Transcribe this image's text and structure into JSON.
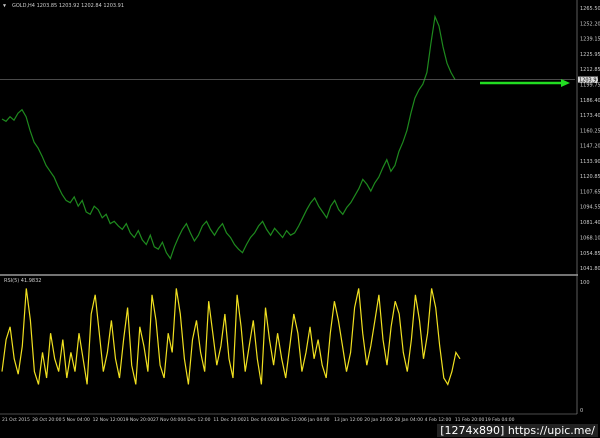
{
  "header": {
    "symbol_ohlc": "GOLD,H4 1203.85 1203.92 1202.84 1203.91",
    "menu_icon": "triangle-down-icon"
  },
  "indicator": {
    "label": "RSI(5) 41.9832"
  },
  "price_axis_labels": [
    "1265.50",
    "1252.20",
    "1239.15",
    "1225.95",
    "1212.85",
    "1199.75",
    "1186.40",
    "1173.40",
    "1160.25",
    "1147.20",
    "1133.90",
    "1120.85",
    "1107.65",
    "1094.55",
    "1081.40",
    "1068.10",
    "1054.85",
    "1041.80"
  ],
  "current_price": "1203.91",
  "rsi_axis_labels": [
    "100",
    "0"
  ],
  "time_axis_labels": [
    "21 Oct 2015",
    "28 Oct 20:00",
    "5 Nov 04:00",
    "12 Nov 12:00",
    "19 Nov 20:00",
    "27 Nov 04:00",
    "4 Dec 12:00",
    "11 Dec 20:00",
    "21 Dec 04:00",
    "28 Dec 12:00",
    "6 Jan 04:00",
    "13 Jan 12:00",
    "20 Jan 20:00",
    "28 Jan 04:00",
    "4 Feb 12:00",
    "11 Feb 20:00",
    "19 Feb 04:00"
  ],
  "watermark": "[1274x890] https://upic.me/",
  "colors": {
    "background": "#000000",
    "price_line": "#1e8a1e",
    "rsi_line": "#f0e020",
    "arrow": "#22dd22",
    "separator": "#9a9a9a",
    "axis_text": "#cccccc"
  },
  "chart_data": [
    {
      "type": "line",
      "series": [
        {
          "values": [
            1170,
            1168,
            1172,
            1169,
            1175,
            1178,
            1172,
            1160,
            1150,
            1145,
            1138,
            1130,
            1125,
            1120,
            1112,
            1105,
            1100,
            1098,
            1103,
            1095,
            1100,
            1090,
            1088,
            1095,
            1092,
            1085,
            1088,
            1080,
            1082,
            1078,
            1075,
            1080,
            1072,
            1068,
            1074,
            1066,
            1062,
            1070,
            1060,
            1058,
            1064,
            1055,
            1050,
            1060,
            1068,
            1075,
            1080,
            1072,
            1065,
            1070,
            1078,
            1082,
            1075,
            1070,
            1076,
            1080,
            1072,
            1068,
            1062,
            1058,
            1055,
            1062,
            1068,
            1072,
            1078,
            1082,
            1075,
            1070,
            1076,
            1072,
            1068,
            1074,
            1070,
            1072,
            1078,
            1085,
            1092,
            1098,
            1102,
            1095,
            1090,
            1085,
            1095,
            1100,
            1092,
            1088,
            1094,
            1098,
            1104,
            1110,
            1118,
            1114,
            1108,
            1115,
            1120,
            1128,
            1135,
            1125,
            1130,
            1142,
            1150,
            1160,
            1175,
            1188,
            1195,
            1200,
            1210,
            1235,
            1258,
            1250,
            1232,
            1218,
            1210,
            1204
          ]
        }
      ],
      "ylim": [
        1041.8,
        1265.5
      ],
      "ytick_labels": [
        "1265.50",
        "1252.20",
        "1239.15",
        "1225.95",
        "1212.85",
        "1199.75",
        "1186.40",
        "1173.40",
        "1160.25",
        "1147.20",
        "1133.90",
        "1120.85",
        "1107.65",
        "1094.55",
        "1081.40",
        "1068.10",
        "1054.85",
        "1041.80"
      ],
      "current_price": 1203.91
    },
    {
      "type": "line",
      "series": [
        {
          "values": [
            30,
            55,
            65,
            40,
            28,
            50,
            95,
            70,
            30,
            20,
            45,
            25,
            60,
            40,
            30,
            55,
            25,
            45,
            30,
            60,
            40,
            20,
            75,
            90,
            60,
            30,
            45,
            70,
            40,
            25,
            55,
            80,
            35,
            20,
            65,
            50,
            30,
            90,
            70,
            35,
            25,
            60,
            45,
            95,
            75,
            40,
            20,
            55,
            70,
            45,
            30,
            85,
            60,
            35,
            50,
            75,
            40,
            25,
            90,
            65,
            30,
            50,
            70,
            40,
            20,
            80,
            55,
            35,
            60,
            40,
            25,
            50,
            75,
            60,
            30,
            45,
            65,
            40,
            55,
            35,
            25,
            60,
            85,
            70,
            50,
            30,
            45,
            80,
            95,
            60,
            35,
            50,
            70,
            90,
            55,
            35,
            65,
            85,
            75,
            45,
            30,
            55,
            90,
            70,
            40,
            60,
            95,
            80,
            50,
            25,
            20,
            30,
            45,
            40
          ]
        }
      ],
      "ylim": [
        0,
        100
      ],
      "ytick_labels": [
        "100",
        "0"
      ]
    }
  ]
}
